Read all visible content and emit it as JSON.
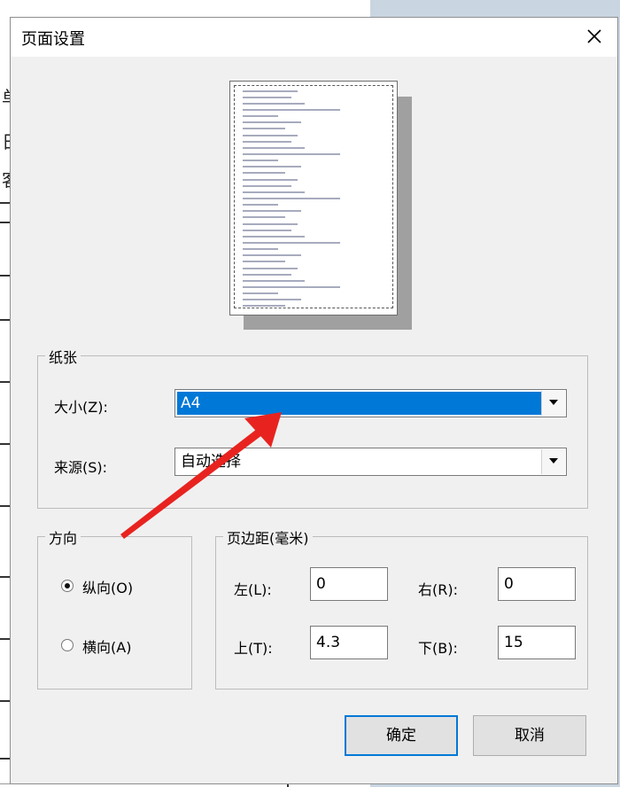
{
  "background": {
    "side_chars": [
      "单",
      "日",
      "客"
    ]
  },
  "dialog": {
    "title": "页面设置",
    "close_icon": "close-icon",
    "paper_group": {
      "label": "纸张",
      "size_label": "大小(Z):",
      "size_value": "A4",
      "source_label": "来源(S):",
      "source_value": "自动选择"
    },
    "orientation_group": {
      "label": "方向",
      "portrait_label": "纵向(O)",
      "landscape_label": "横向(A)",
      "selected": "portrait"
    },
    "margins_group": {
      "label": "页边距(毫米)",
      "left_label": "左(L):",
      "left_value": "0",
      "right_label": "右(R):",
      "right_value": "0",
      "top_label": "上(T):",
      "top_value": "4.3",
      "bottom_label": "下(B):",
      "bottom_value": "15"
    },
    "buttons": {
      "ok_label": "确定",
      "cancel_label": "取消"
    }
  },
  "colors": {
    "selection": "#0078d7",
    "arrow": "#e8231f",
    "dialog_bg": "#f0f0f0"
  }
}
